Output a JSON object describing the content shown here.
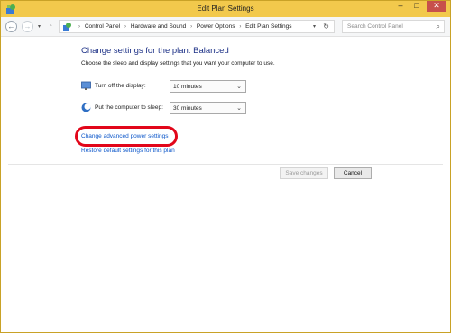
{
  "window": {
    "title": "Edit Plan Settings",
    "controls": {
      "minimize": "–",
      "maximize": "□",
      "close": "✕"
    }
  },
  "addressbar": {
    "crumbs": [
      "Control Panel",
      "Hardware and Sound",
      "Power Options",
      "Edit Plan Settings"
    ],
    "search_placeholder": "Search Control Panel",
    "icons": {
      "back": "back-arrow-icon",
      "forward": "forward-arrow-icon",
      "up": "up-arrow-icon",
      "refresh": "refresh-icon",
      "search": "search-icon"
    }
  },
  "main": {
    "heading": "Change settings for the plan: Balanced",
    "subheading": "Choose the sleep and display settings that you want your computer to use.",
    "settings": [
      {
        "label": "Turn off the display:",
        "value": "10 minutes",
        "icon": "monitor-icon"
      },
      {
        "label": "Put the computer to sleep:",
        "value": "30 minutes",
        "icon": "sleep-moon-icon"
      }
    ],
    "links": {
      "advanced": "Change advanced power settings",
      "restore": "Restore default settings for this plan"
    },
    "buttons": {
      "save": "Save changes",
      "cancel": "Cancel"
    }
  },
  "colors": {
    "titlebar": "#f2c94c",
    "heading": "#1e3287",
    "link": "#0a55c9",
    "highlight": "#e2061a"
  }
}
